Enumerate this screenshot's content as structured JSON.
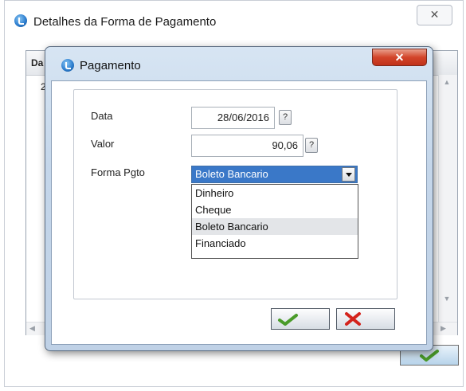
{
  "outer_window": {
    "title": "Detalhes da Forma de Pagamento",
    "close_glyph": "✕",
    "grid": {
      "col_header": "Da",
      "row_value": "2"
    }
  },
  "dialog": {
    "title": "Pagamento",
    "close_glyph": "✕",
    "fields": {
      "data_label": "Data",
      "data_value": "28/06/2016",
      "valor_label": "Valor",
      "valor_value": "90,06",
      "forma_label": "Forma Pgto",
      "forma_value": "Boleto Bancario",
      "help_glyph": "?"
    },
    "dropdown_options": [
      "Dinheiro",
      "Cheque",
      "Boleto Bancario",
      "Financiado"
    ],
    "selected_option_index": 2
  },
  "icons": {
    "app": "app-logo-icon",
    "ok": "checkmark-icon",
    "cancel": "x-icon"
  },
  "colors": {
    "combo_selected": "#3a78c8",
    "close_red": "#c0311a",
    "ok_green": "#4a9b2a",
    "cancel_red": "#d4231c"
  }
}
